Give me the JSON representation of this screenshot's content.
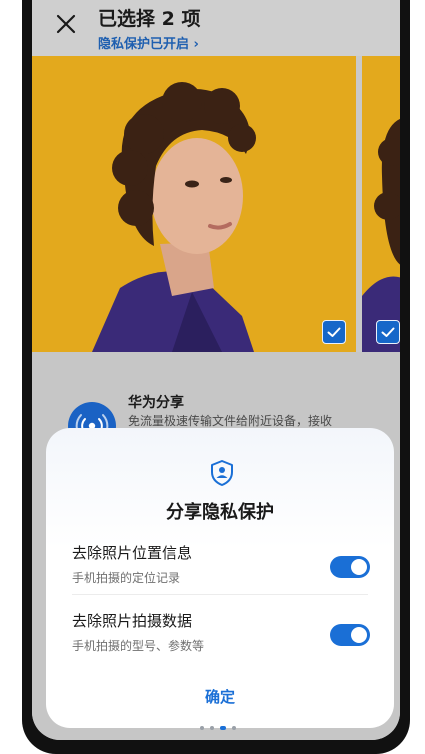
{
  "header": {
    "title": "已选择 2 项",
    "privacy_link": "隐私保护已开启",
    "privacy_chevron": "›"
  },
  "share": {
    "title": "华为分享",
    "description": "免流量极速传输文件给附近设备，接收"
  },
  "dialog": {
    "title": "分享隐私保护",
    "options": [
      {
        "title": "去除照片位置信息",
        "subtitle": "手机拍摄的定位记录",
        "enabled": true
      },
      {
        "title": "去除照片拍摄数据",
        "subtitle": "手机拍摄的型号、参数等",
        "enabled": true
      }
    ],
    "confirm_label": "确定"
  },
  "colors": {
    "accent": "#1a6fd6",
    "photo_background": "#e1a71e",
    "link": "#1e5fb0"
  },
  "icons": {
    "close": "close-icon",
    "check": "checkmark-icon",
    "share": "huawei-share-icon",
    "privacy": "privacy-shield-icon"
  }
}
